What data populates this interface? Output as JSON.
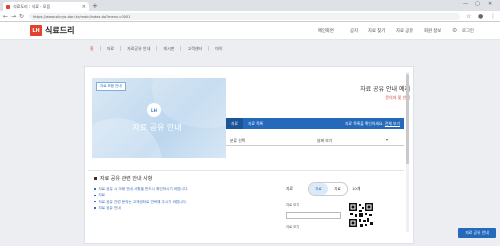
{
  "browser": {
    "tab_title": "식료도리 : 식료 · 모음",
    "tab_close": "×",
    "new_tab": "+",
    "url": "https://www.sikryo-dori.kr/main/index.do?menu=0001",
    "window_controls": [
      "—",
      "▢",
      "✕"
    ]
  },
  "header": {
    "logo_mark": "LH",
    "logo_text": "식료드리",
    "nav": [
      "메인화면",
      "공지",
      "자료 찾기",
      "자료 공유",
      "회원 정보"
    ],
    "user": "로그인"
  },
  "subtabs": [
    "홈",
    "자료",
    "자료공유 안내",
    "게시판",
    "고객센터",
    "마이"
  ],
  "banner": {
    "tag": "자료 모음 안내",
    "circle": "LH",
    "text": "자료 공유 안내"
  },
  "info": {
    "title": "자료 공유 안내 예제",
    "subtitle": "문의처 및 안내"
  },
  "bluebar": {
    "items": [
      "자료",
      "자료 목록"
    ],
    "right_text": "자료 목록을 확인하세요.",
    "right_link": "전체 보기"
  },
  "select_row": {
    "left": "분류 선택",
    "right": "날짜 보기",
    "caret": "▾"
  },
  "notice": {
    "heading": "자료 공유 관련 안내 사항",
    "items": [
      "자료 공유 시 아래 안내 사항을 반드시 확인하시기 바랍니다.",
      "자료",
      "자료 공유 관련 문의는 고객센터로 연락해 주시기 바랍니다.",
      "자료 공유 안내"
    ]
  },
  "side": {
    "label": "자료",
    "toggle_on": "자료",
    "toggle_off": "자료",
    "count": "10개",
    "line1": "자료 보기",
    "line2": "자료",
    "bottom": "자료 보기"
  },
  "float_button": "자료 공유 안내",
  "colors": {
    "brand_red": "#e2422d",
    "primary_blue": "#2469ba"
  }
}
